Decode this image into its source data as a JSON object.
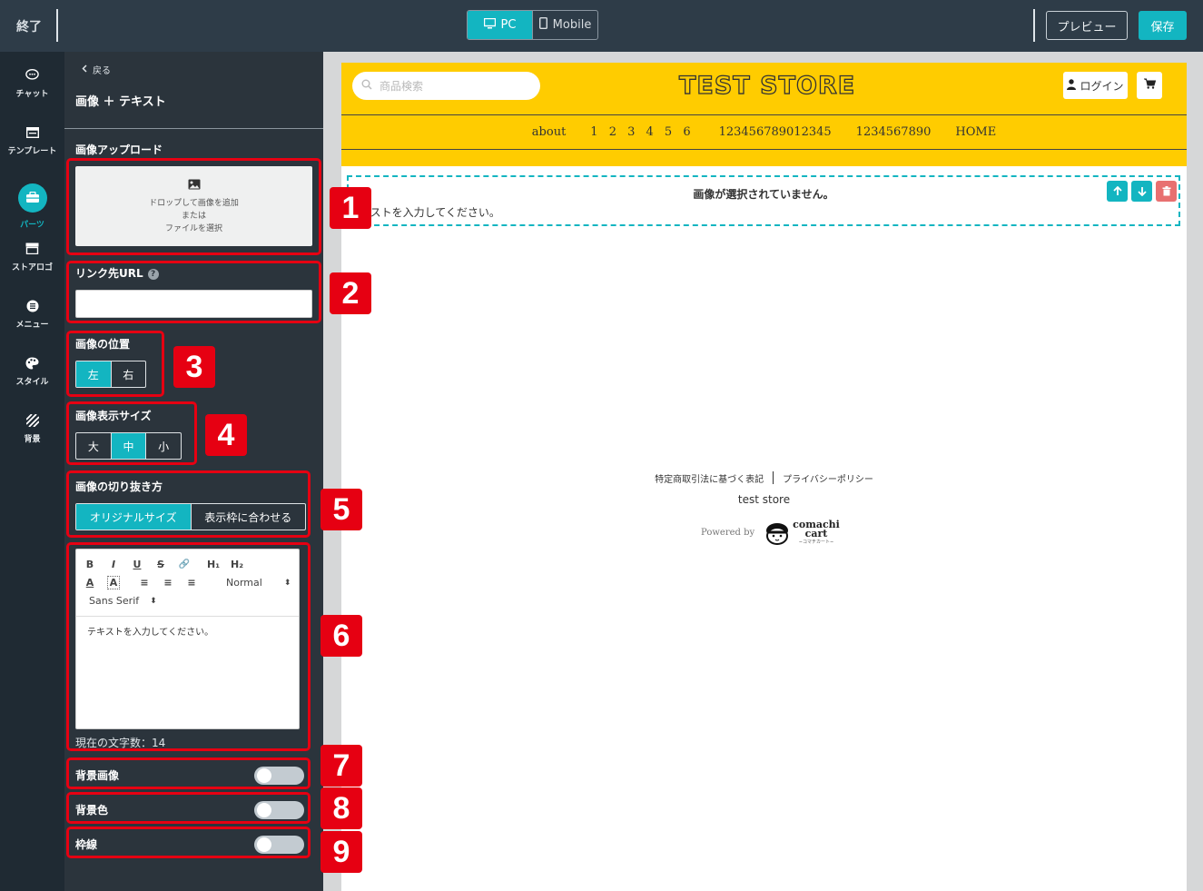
{
  "topbar": {
    "exit_label": "終了",
    "device_pc": "PC",
    "device_mobile": "Mobile",
    "preview_label": "プレビュー",
    "save_label": "保存",
    "accent_color": "#13b5c1"
  },
  "rail": {
    "items": [
      {
        "label": "チャット",
        "icon": "chat-icon"
      },
      {
        "label": "テンプレート",
        "icon": "template-icon"
      },
      {
        "label": "パーツ",
        "icon": "parts-icon",
        "active": true
      },
      {
        "label": "ストアロゴ",
        "icon": "store-icon"
      },
      {
        "label": "メニュー",
        "icon": "menu-icon"
      },
      {
        "label": "スタイル",
        "icon": "palette-icon"
      },
      {
        "label": "背景",
        "icon": "background-icon"
      }
    ]
  },
  "panel": {
    "back_label": "戻る",
    "title": "画像 ＋ テキスト",
    "upload": {
      "label": "画像アップロード",
      "line1": "ドロップして画像を追加",
      "line2": "または",
      "line3": "ファイルを選択"
    },
    "link": {
      "label": "リンク先URL",
      "help": "?",
      "value": ""
    },
    "position": {
      "label": "画像の位置",
      "options": [
        "左",
        "右"
      ],
      "selected": "左"
    },
    "size": {
      "label": "画像表示サイズ",
      "options": [
        "大",
        "中",
        "小"
      ],
      "selected": "中"
    },
    "crop": {
      "label": "画像の切り抜き方",
      "options": [
        "オリジナルサイズ",
        "表示枠に合わせる"
      ],
      "selected": "オリジナルサイズ"
    },
    "editor": {
      "tools_row1": [
        "B",
        "I",
        "U",
        "S",
        "🔗",
        "H₁",
        "H₂"
      ],
      "tools_row2": [
        "A",
        "A",
        "≡",
        "≡",
        "≡"
      ],
      "header_select": "Normal",
      "font_select": "Sans Serif",
      "content": "テキストを入力してください。",
      "char_count": "現在の文字数：14"
    },
    "toggles": {
      "bg_image": {
        "label": "背景画像",
        "on": false
      },
      "bg_color": {
        "label": "背景色",
        "on": false
      },
      "border": {
        "label": "枠線",
        "on": false
      }
    }
  },
  "store": {
    "search_placeholder": "商品検索",
    "title": "TEST STORE",
    "login_label": "ログイン",
    "nav": [
      "about",
      "1 2 3 4 5 6",
      "123456789012345",
      "1234567890",
      "HOME"
    ],
    "header_color": "#ffcc00",
    "block_message": "画像が選択されていません。",
    "block_text": "テキストを入力してください。",
    "footer_link1": "特定商取引法に基づく表記",
    "footer_link2": "プライバシーポリシー",
    "footer_store": "test store",
    "powered_by": "Powered by",
    "logo_line1": "comachi",
    "logo_line2": "cart",
    "logo_sub": "~コマチカート~"
  },
  "callouts": [
    "1",
    "2",
    "3",
    "4",
    "5",
    "6",
    "7",
    "8",
    "9"
  ]
}
